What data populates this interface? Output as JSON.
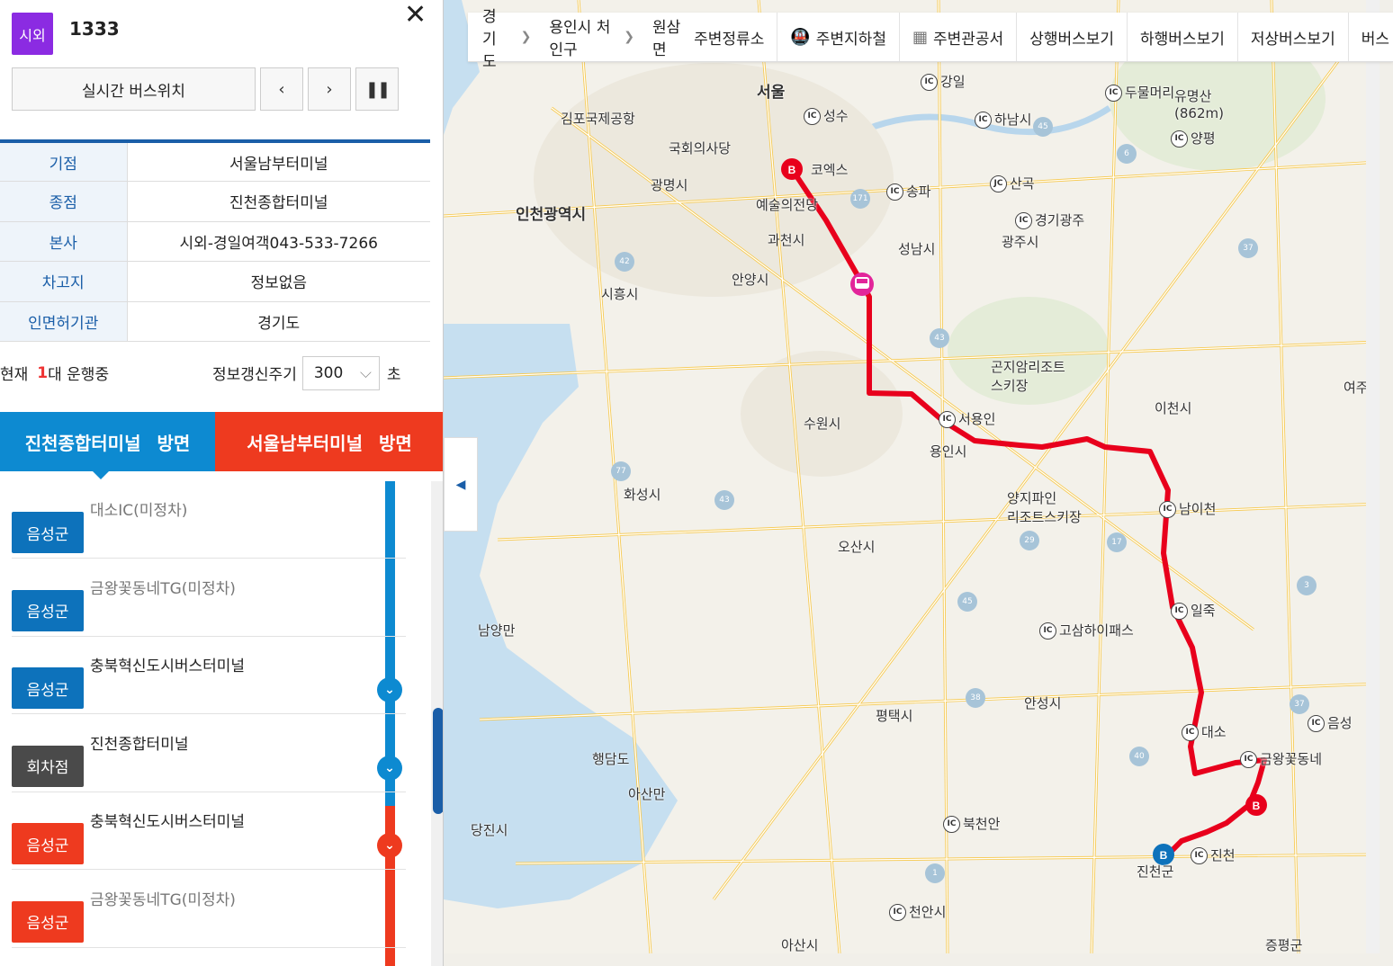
{
  "route": {
    "type_label": "시외",
    "type_color": "#8b2be2",
    "number": "1333",
    "close_icon": "close-icon"
  },
  "controls": {
    "realtime_label": "실시간 버스위치",
    "prev_icon": "chevron-left-icon",
    "next_icon": "chevron-right-icon",
    "pause_icon": "pause-icon"
  },
  "info": [
    {
      "label": "기점",
      "value": "서울남부터미널"
    },
    {
      "label": "종점",
      "value": "진천종합터미널"
    },
    {
      "label": "본사",
      "value": "시외-경일여객043-533-7266"
    },
    {
      "label": "차고지",
      "value": "정보없음"
    },
    {
      "label": "인면허기관",
      "value": "경기도"
    }
  ],
  "status": {
    "prefix": "현재",
    "count": "1",
    "suffix": "대 운행중",
    "refresh_label": "정보갱신주기",
    "refresh_value": "300",
    "refresh_unit": "초"
  },
  "directions": {
    "to_end": {
      "name": "진천종합터미널",
      "suffix": "방면"
    },
    "to_start": {
      "name": "서울남부터미널",
      "suffix": "방면"
    }
  },
  "stops": [
    {
      "region": "음성군",
      "name": "대소IC(미정차)",
      "kind": "blue",
      "muted": true,
      "chevron": ""
    },
    {
      "region": "음성군",
      "name": "금왕꽃동네TG(미정차)",
      "kind": "blue",
      "muted": true,
      "chevron": ""
    },
    {
      "region": "음성군",
      "name": "충북혁신도시버스터미널",
      "kind": "blue",
      "muted": false,
      "chevron": "blue"
    },
    {
      "region": "회차점",
      "name": "진천종합터미널",
      "kind": "dark",
      "muted": false,
      "chevron": "blue"
    },
    {
      "region": "음성군",
      "name": "충북혁신도시버스터미널",
      "kind": "red",
      "muted": false,
      "chevron": "red"
    },
    {
      "region": "음성군",
      "name": "금왕꽃동네TG(미정차)",
      "kind": "red",
      "muted": true,
      "chevron": ""
    }
  ],
  "toolbar": {
    "breadcrumb": [
      "경기도",
      "용인시 처인구",
      "원삼면"
    ],
    "buttons": [
      {
        "label": "주변정류소",
        "icon": ""
      },
      {
        "label": "주변지하철",
        "icon": "subway-icon"
      },
      {
        "label": "주변관공서",
        "icon": "building-icon"
      },
      {
        "label": "상행버스보기",
        "icon": ""
      },
      {
        "label": "하행버스보기",
        "icon": ""
      },
      {
        "label": "저상버스보기",
        "icon": ""
      },
      {
        "label": "버스",
        "icon": ""
      }
    ]
  },
  "map": {
    "route_color": "#e8001c",
    "labels": [
      {
        "text": "서울",
        "big": true,
        "ic": ""
      },
      {
        "text": "인천광역시",
        "big": true,
        "ic": ""
      },
      {
        "text": "강일",
        "ic": "IC"
      },
      {
        "text": "하남시",
        "ic": "IC"
      },
      {
        "text": "성수",
        "ic": "IC"
      },
      {
        "text": "두물머리",
        "ic": "IC"
      },
      {
        "text": "양평",
        "ic": "IC"
      },
      {
        "text": "송파",
        "ic": "IC"
      },
      {
        "text": "산곡",
        "ic": "JC"
      },
      {
        "text": "경기광주",
        "ic": "IC"
      },
      {
        "text": "광주시",
        "ic": ""
      },
      {
        "text": "성남시",
        "ic": ""
      },
      {
        "text": "과천시",
        "ic": ""
      },
      {
        "text": "광명시",
        "ic": ""
      },
      {
        "text": "안양시",
        "ic": ""
      },
      {
        "text": "시흥시",
        "ic": ""
      },
      {
        "text": "수원시",
        "ic": ""
      },
      {
        "text": "용인시",
        "ic": ""
      },
      {
        "text": "서용인",
        "ic": "IC"
      },
      {
        "text": "이천시",
        "ic": ""
      },
      {
        "text": "여주시",
        "ic": ""
      },
      {
        "text": "화성시",
        "ic": ""
      },
      {
        "text": "오산시",
        "ic": ""
      },
      {
        "text": "평택시",
        "ic": ""
      },
      {
        "text": "안성시",
        "ic": ""
      },
      {
        "text": "남이천",
        "ic": "IC"
      },
      {
        "text": "일죽",
        "ic": "IC"
      },
      {
        "text": "대소",
        "ic": "IC"
      },
      {
        "text": "금왕꽃동네",
        "ic": "IC"
      },
      {
        "text": "진천",
        "ic": "IC"
      },
      {
        "text": "진천군",
        "ic": ""
      },
      {
        "text": "음성",
        "ic": "IC"
      },
      {
        "text": "아산시",
        "ic": ""
      },
      {
        "text": "천안시",
        "ic": "IC"
      },
      {
        "text": "북천안",
        "ic": "IC"
      },
      {
        "text": "당진시",
        "ic": ""
      },
      {
        "text": "남양만",
        "ic": ""
      },
      {
        "text": "아산만",
        "ic": ""
      },
      {
        "text": "행담도",
        "ic": ""
      },
      {
        "text": "유명산\n(862m)",
        "ic": ""
      },
      {
        "text": "곤지암리조트\n스키장",
        "ic": ""
      },
      {
        "text": "양지파인\n리조트스키장",
        "ic": ""
      },
      {
        "text": "고삼하이패스",
        "ic": "IC"
      },
      {
        "text": "코엑스",
        "ic": ""
      },
      {
        "text": "예술의전당",
        "ic": ""
      },
      {
        "text": "김포국제공항",
        "ic": ""
      },
      {
        "text": "국회의사당",
        "ic": ""
      },
      {
        "text": "증평군",
        "ic": ""
      }
    ]
  }
}
